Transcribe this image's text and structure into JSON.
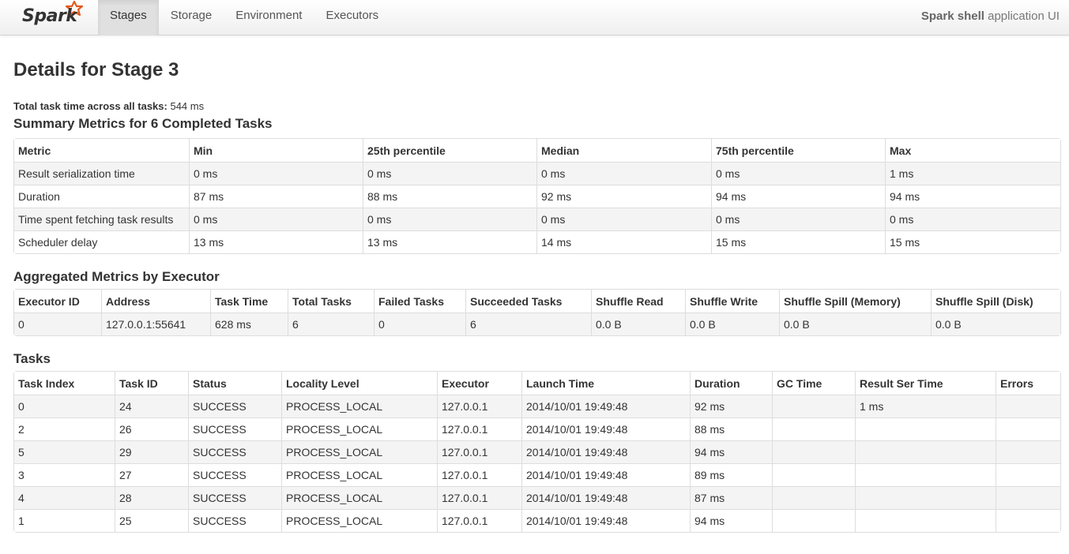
{
  "navbar": {
    "brand": "Spark",
    "tabs": [
      {
        "label": "Stages",
        "active": true
      },
      {
        "label": "Storage",
        "active": false
      },
      {
        "label": "Environment",
        "active": false
      },
      {
        "label": "Executors",
        "active": false
      }
    ],
    "app_name": "Spark shell",
    "app_suffix": " application UI"
  },
  "page": {
    "title": "Details for Stage 3",
    "total_label": "Total task time across all tasks:",
    "total_value": " 544 ms"
  },
  "summary": {
    "title": "Summary Metrics for 6 Completed Tasks",
    "headers": [
      "Metric",
      "Min",
      "25th percentile",
      "Median",
      "75th percentile",
      "Max"
    ],
    "rows": [
      [
        "Result serialization time",
        "0 ms",
        "0 ms",
        "0 ms",
        "0 ms",
        "1 ms"
      ],
      [
        "Duration",
        "87 ms",
        "88 ms",
        "92 ms",
        "94 ms",
        "94 ms"
      ],
      [
        "Time spent fetching task results",
        "0 ms",
        "0 ms",
        "0 ms",
        "0 ms",
        "0 ms"
      ],
      [
        "Scheduler delay",
        "13 ms",
        "13 ms",
        "14 ms",
        "15 ms",
        "15 ms"
      ]
    ]
  },
  "aggregated": {
    "title": "Aggregated Metrics by Executor",
    "headers": [
      "Executor ID",
      "Address",
      "Task Time",
      "Total Tasks",
      "Failed Tasks",
      "Succeeded Tasks",
      "Shuffle Read",
      "Shuffle Write",
      "Shuffle Spill (Memory)",
      "Shuffle Spill (Disk)"
    ],
    "rows": [
      [
        "0",
        "127.0.0.1:55641",
        "628 ms",
        "6",
        "0",
        "6",
        "0.0 B",
        "0.0 B",
        "0.0 B",
        "0.0 B"
      ]
    ]
  },
  "tasks": {
    "title": "Tasks",
    "headers": [
      "Task Index",
      "Task ID",
      "Status",
      "Locality Level",
      "Executor",
      "Launch Time",
      "Duration",
      "GC Time",
      "Result Ser Time",
      "Errors"
    ],
    "rows": [
      [
        "0",
        "24",
        "SUCCESS",
        "PROCESS_LOCAL",
        "127.0.0.1",
        "2014/10/01 19:49:48",
        "92 ms",
        "",
        "1 ms",
        ""
      ],
      [
        "2",
        "26",
        "SUCCESS",
        "PROCESS_LOCAL",
        "127.0.0.1",
        "2014/10/01 19:49:48",
        "88 ms",
        "",
        "",
        ""
      ],
      [
        "5",
        "29",
        "SUCCESS",
        "PROCESS_LOCAL",
        "127.0.0.1",
        "2014/10/01 19:49:48",
        "94 ms",
        "",
        "",
        ""
      ],
      [
        "3",
        "27",
        "SUCCESS",
        "PROCESS_LOCAL",
        "127.0.0.1",
        "2014/10/01 19:49:48",
        "89 ms",
        "",
        "",
        ""
      ],
      [
        "4",
        "28",
        "SUCCESS",
        "PROCESS_LOCAL",
        "127.0.0.1",
        "2014/10/01 19:49:48",
        "87 ms",
        "",
        "",
        ""
      ],
      [
        "1",
        "25",
        "SUCCESS",
        "PROCESS_LOCAL",
        "127.0.0.1",
        "2014/10/01 19:49:48",
        "94 ms",
        "",
        "",
        ""
      ]
    ]
  },
  "colors": {
    "logo_star": "#e25a1c",
    "text": "#333333",
    "stripe": "#f4f4f4",
    "border": "#dddddd"
  }
}
